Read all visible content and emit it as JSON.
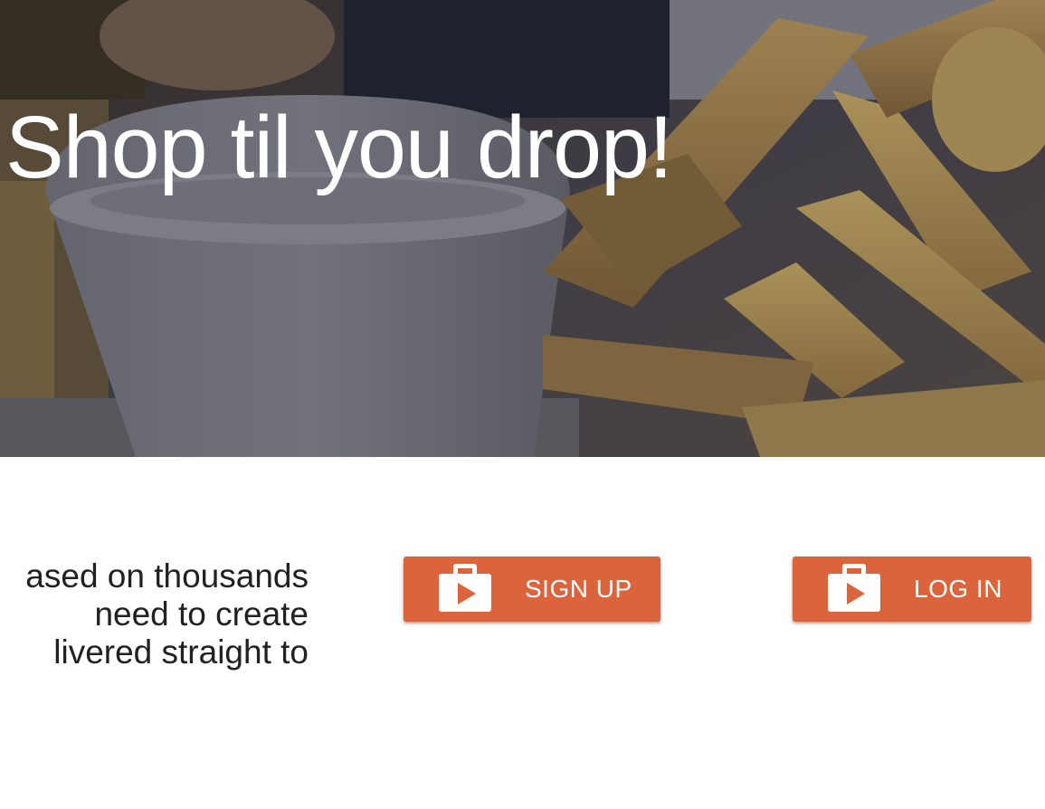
{
  "hero": {
    "title": "Shop til you drop!",
    "image_description_icon": "food-photo"
  },
  "main": {
    "blurb_lines": [
      "ased on thousands",
      "need to create",
      "livered straight to"
    ]
  },
  "actions": {
    "signup_label": "SIGN UP",
    "login_label": "LOG IN",
    "button_icon": "shopping-bag-play-icon"
  },
  "colors": {
    "button": "#dc643d",
    "button_text": "#ffffff",
    "body_text": "#212121",
    "hero_text": "#ffffff"
  }
}
